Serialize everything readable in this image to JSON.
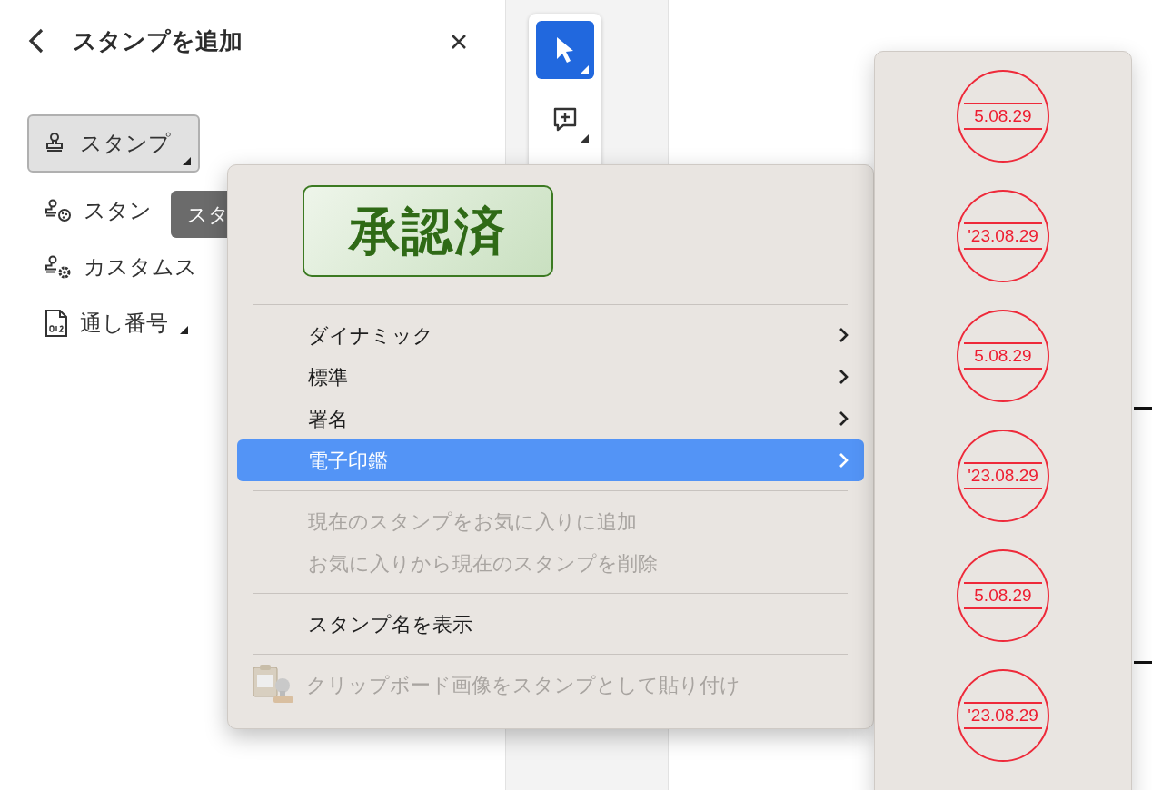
{
  "panel": {
    "title": "スタンプを追加",
    "items": [
      {
        "label": "スタンプ",
        "kind": "stamp",
        "selected": true,
        "dropdown": true
      },
      {
        "label": "スタン",
        "kind": "stamp-palette",
        "selected": false,
        "dropdown": false
      },
      {
        "label": "カスタムス",
        "kind": "stamp-gear",
        "selected": false,
        "dropdown": false
      },
      {
        "label": "通し番号",
        "kind": "numbered-file",
        "selected": false,
        "dropdown": true
      }
    ]
  },
  "tooltip": {
    "text": "スタ"
  },
  "toolbar": {
    "tools": [
      {
        "kind": "select",
        "selected": true
      },
      {
        "kind": "comment",
        "selected": false
      }
    ]
  },
  "menu": {
    "preview": {
      "text": "承認済"
    },
    "sections": [
      {
        "items": [
          {
            "label": "ダイナミック",
            "kind": "submenu",
            "selected": false,
            "disabled": false
          },
          {
            "label": "標準",
            "kind": "submenu",
            "selected": false,
            "disabled": false
          },
          {
            "label": "署名",
            "kind": "submenu",
            "selected": false,
            "disabled": false
          },
          {
            "label": "電子印鑑",
            "kind": "submenu",
            "selected": true,
            "disabled": false
          }
        ]
      },
      {
        "items": [
          {
            "label": "現在のスタンプをお気に入りに追加",
            "kind": "action",
            "selected": false,
            "disabled": true
          },
          {
            "label": "お気に入りから現在のスタンプを削除",
            "kind": "action",
            "selected": false,
            "disabled": true
          }
        ]
      },
      {
        "items": [
          {
            "label": "スタンプ名を表示",
            "kind": "action",
            "selected": false,
            "disabled": false
          }
        ]
      },
      {
        "items": [
          {
            "label": "クリップボード画像をスタンプとして貼り付け",
            "kind": "paste",
            "selected": false,
            "disabled": true
          }
        ]
      }
    ]
  },
  "submenu": {
    "stamps": [
      {
        "date": "5.08.29"
      },
      {
        "date": "'23.08.29"
      },
      {
        "date": "5.08.29"
      },
      {
        "date": "'23.08.29"
      },
      {
        "date": "5.08.29"
      },
      {
        "date": "'23.08.29"
      }
    ]
  }
}
